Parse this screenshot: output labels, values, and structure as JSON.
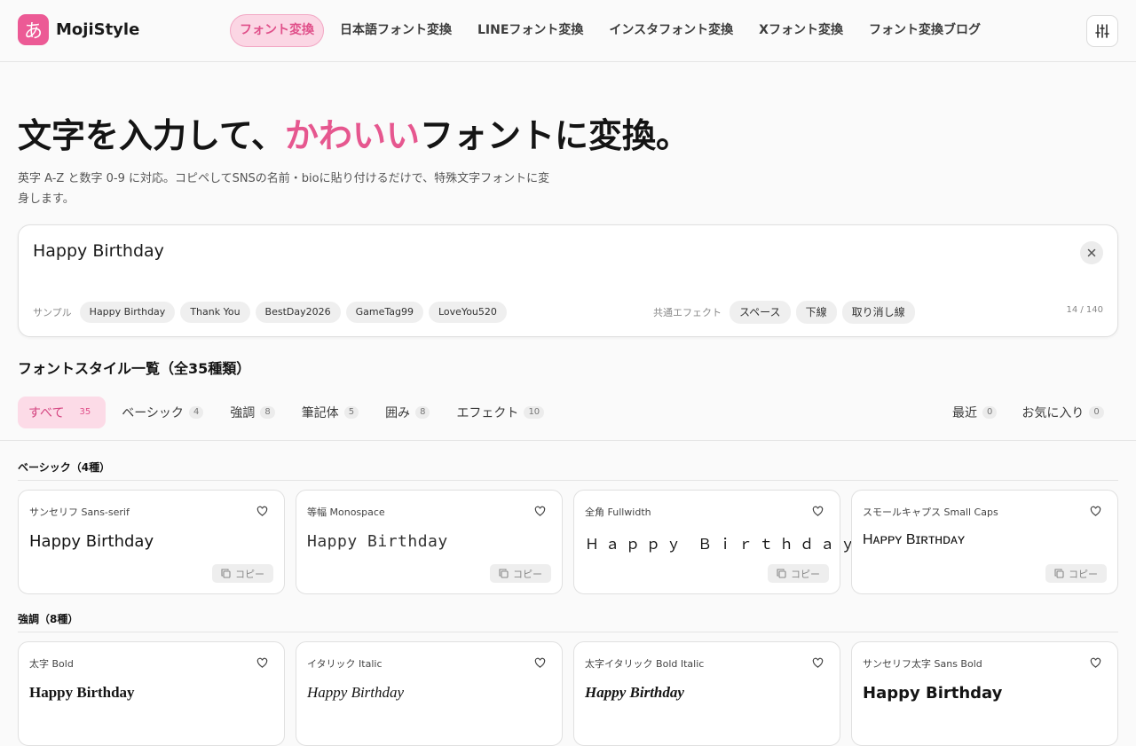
{
  "header": {
    "logo_char": "あ",
    "logo_text": "MojiStyle",
    "nav": [
      "フォント変換",
      "日本語フォント変換",
      "LINEフォント変換",
      "インスタフォント変換",
      "Xフォント変換",
      "フォント変換ブログ"
    ]
  },
  "hero": {
    "title_pre": "文字を入力して、",
    "title_accent": "かわいい",
    "title_post": "フォントに変換。",
    "subtitle": "英字 A-Z と数字 0-9 に対応。コピペしてSNSの名前・bioに貼り付けるだけで、特殊文字フォントに変身します。"
  },
  "input": {
    "value": "Happy Birthday",
    "samples_label": "サンプル",
    "samples": [
      "Happy Birthday",
      "Thank You",
      "BestDay2026",
      "GameTag99",
      "LoveYou520"
    ],
    "effects_label": "共通エフェクト",
    "effects": [
      "スペース",
      "下線",
      "取り消し線"
    ],
    "counter": "14 / 140"
  },
  "list": {
    "title": "フォントスタイル一覧（全35種類）",
    "filters": [
      {
        "label": "すべて",
        "count": "35"
      },
      {
        "label": "ベーシック",
        "count": "4"
      },
      {
        "label": "強調",
        "count": "8"
      },
      {
        "label": "筆記体",
        "count": "5"
      },
      {
        "label": "囲み",
        "count": "8"
      },
      {
        "label": "エフェクト",
        "count": "10"
      }
    ],
    "filters_right": [
      {
        "label": "最近",
        "count": "0"
      },
      {
        "label": "お気に入り",
        "count": "0"
      }
    ]
  },
  "sections": [
    {
      "title": "ベーシック（4種）",
      "cards": [
        {
          "label": "サンセリフ Sans-serif",
          "preview": "Happy Birthday"
        },
        {
          "label": "等幅 Monospace",
          "preview": "Happy Birthday"
        },
        {
          "label": "全角 Fullwidth",
          "preview": "Ｈａｐｐｙ Ｂｉｒｔｈｄａｙ"
        },
        {
          "label": "スモールキャプス Small Caps",
          "preview": "Hᴀᴘᴘʏ Bɪʀᴛʜᴅᴀʏ"
        }
      ]
    },
    {
      "title": "強調（8種）",
      "cards": [
        {
          "label": "太字 Bold",
          "preview": "Happy Birthday"
        },
        {
          "label": "イタリック Italic",
          "preview": "Happy Birthday"
        },
        {
          "label": "太字イタリック Bold Italic",
          "preview": "Happy Birthday"
        },
        {
          "label": "サンセリフ太字 Sans Bold",
          "preview": "Happy Birthday"
        }
      ]
    }
  ],
  "copy_label": "コピー",
  "colors": {
    "accent": "#e6578f",
    "accent_bg": "#fcdbe7"
  }
}
